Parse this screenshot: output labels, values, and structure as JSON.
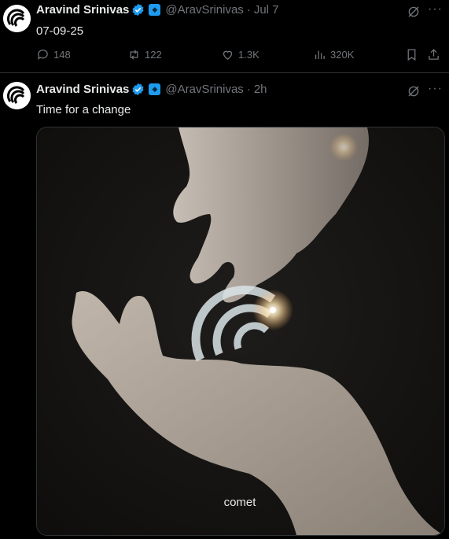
{
  "tweets": [
    {
      "author": "Aravind Srinivas",
      "handle": "@AravSrinivas",
      "time": "Jul 7",
      "text": "07-09-25",
      "stats": {
        "replies": "148",
        "reposts": "122",
        "likes": "1.3K",
        "views": "320K"
      }
    },
    {
      "author": "Aravind Srinivas",
      "handle": "@AravSrinivas",
      "time": "2h",
      "text": "Time for a change",
      "media": {
        "caption": "comet"
      }
    }
  ],
  "ui": {
    "dot": "·",
    "more": "···"
  },
  "colors": {
    "accent": "#1d9bf0",
    "muted": "#71767b",
    "background": "#000000"
  },
  "icons": [
    "avatar",
    "verified-badge-icon",
    "affiliate-badge-icon",
    "grok-icon",
    "more-icon",
    "reply-icon",
    "repost-icon",
    "like-icon",
    "views-icon",
    "bookmark-icon",
    "share-icon"
  ]
}
